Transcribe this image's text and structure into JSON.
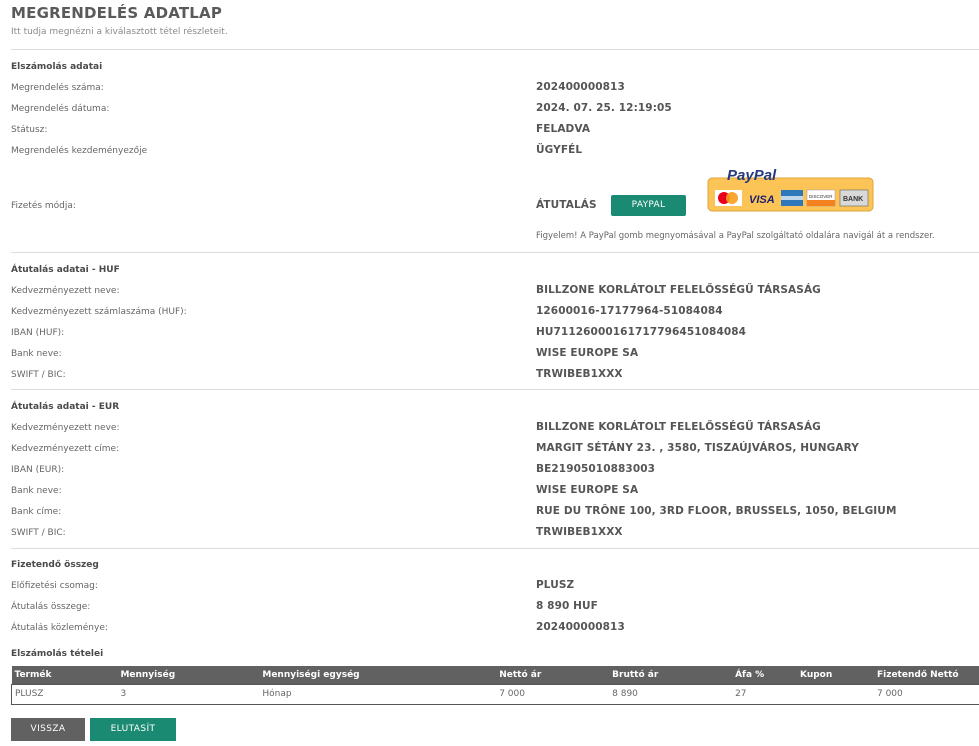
{
  "header": {
    "title": "MEGRENDELÉS ADATLAP",
    "subtitle": "Itt tudja megnézni a kiválasztott tétel részleteit."
  },
  "billing": {
    "title": "Elszámolás adatai",
    "rows": [
      {
        "label": "Megrendelés száma:",
        "value": "202400000813"
      },
      {
        "label": "Megrendelés dátuma:",
        "value": "2024. 07. 25. 12:19:05"
      },
      {
        "label": "Státusz:",
        "value": "FELADVA"
      },
      {
        "label": "Megrendelés kezdeményezője",
        "value": "ÜGYFÉL"
      }
    ],
    "payment_label": "Fizetés módja:",
    "payment_value": "ÁTUTALÁS",
    "paypal_button": "PAYPAL",
    "paypal_logo_text": "PayPal",
    "paypal_cards": [
      "MasterCard",
      "VISA",
      "AMEX",
      "DISCOVER",
      "BANK"
    ],
    "notice": "Figyelem! A PayPal gomb megnyomásával a PayPal szolgáltató oldalára navigál át a rendszer."
  },
  "transfer_huf": {
    "title": "Átutalás adatai - HUF",
    "rows": [
      {
        "label": "Kedvezményezett neve:",
        "value": "BILLZONE KORLÁTOLT FELELŐSSÉGŰ TÁRSASÁG"
      },
      {
        "label": "Kedvezményezett számlaszáma (HUF):",
        "value": "12600016-17177964-51084084"
      },
      {
        "label": "IBAN (HUF):",
        "value": "HU71126000161717796451084084"
      },
      {
        "label": "Bank neve:",
        "value": "WISE EUROPE SA"
      },
      {
        "label": "SWIFT / BIC:",
        "value": "TRWIBEB1XXX"
      }
    ]
  },
  "transfer_eur": {
    "title": "Átutalás adatai - EUR",
    "rows": [
      {
        "label": "Kedvezményezett neve:",
        "value": "BILLZONE KORLÁTOLT FELELŐSSÉGŰ TÁRSASÁG"
      },
      {
        "label": "Kedvezményezett címe:",
        "value": "MARGIT SÉTÁNY 23. , 3580, TISZAÚJVÁROS, HUNGARY"
      },
      {
        "label": "IBAN (EUR):",
        "value": "BE21905010883003"
      },
      {
        "label": "Bank neve:",
        "value": "WISE EUROPE SA"
      },
      {
        "label": "Bank címe:",
        "value": "RUE DU TRÔNE 100, 3RD FLOOR, BRUSSELS, 1050, BELGIUM"
      },
      {
        "label": "SWIFT / BIC:",
        "value": "TRWIBEB1XXX"
      }
    ]
  },
  "payable": {
    "title": "Fizetendő összeg",
    "rows": [
      {
        "label": "Előfizetési csomag:",
        "value": "PLUSZ"
      },
      {
        "label": "Átutalás összege:",
        "value": "8 890 HUF"
      },
      {
        "label": "Átutalás közleménye:",
        "value": "202400000813"
      }
    ]
  },
  "items": {
    "title": "Elszámolás tételei",
    "columns": [
      "Termék",
      "Mennyiség",
      "Mennyiségi egység",
      "Nettó ár",
      "Bruttó ár",
      "Áfa %",
      "Kupon",
      "Fizetendő Nettó"
    ],
    "rows": [
      [
        "PLUSZ",
        "3",
        "Hónap",
        "7 000",
        "8 890",
        "27",
        "",
        "7 000"
      ]
    ]
  },
  "actions": {
    "back": "VISSZA",
    "reject": "ELUTASÍT"
  }
}
